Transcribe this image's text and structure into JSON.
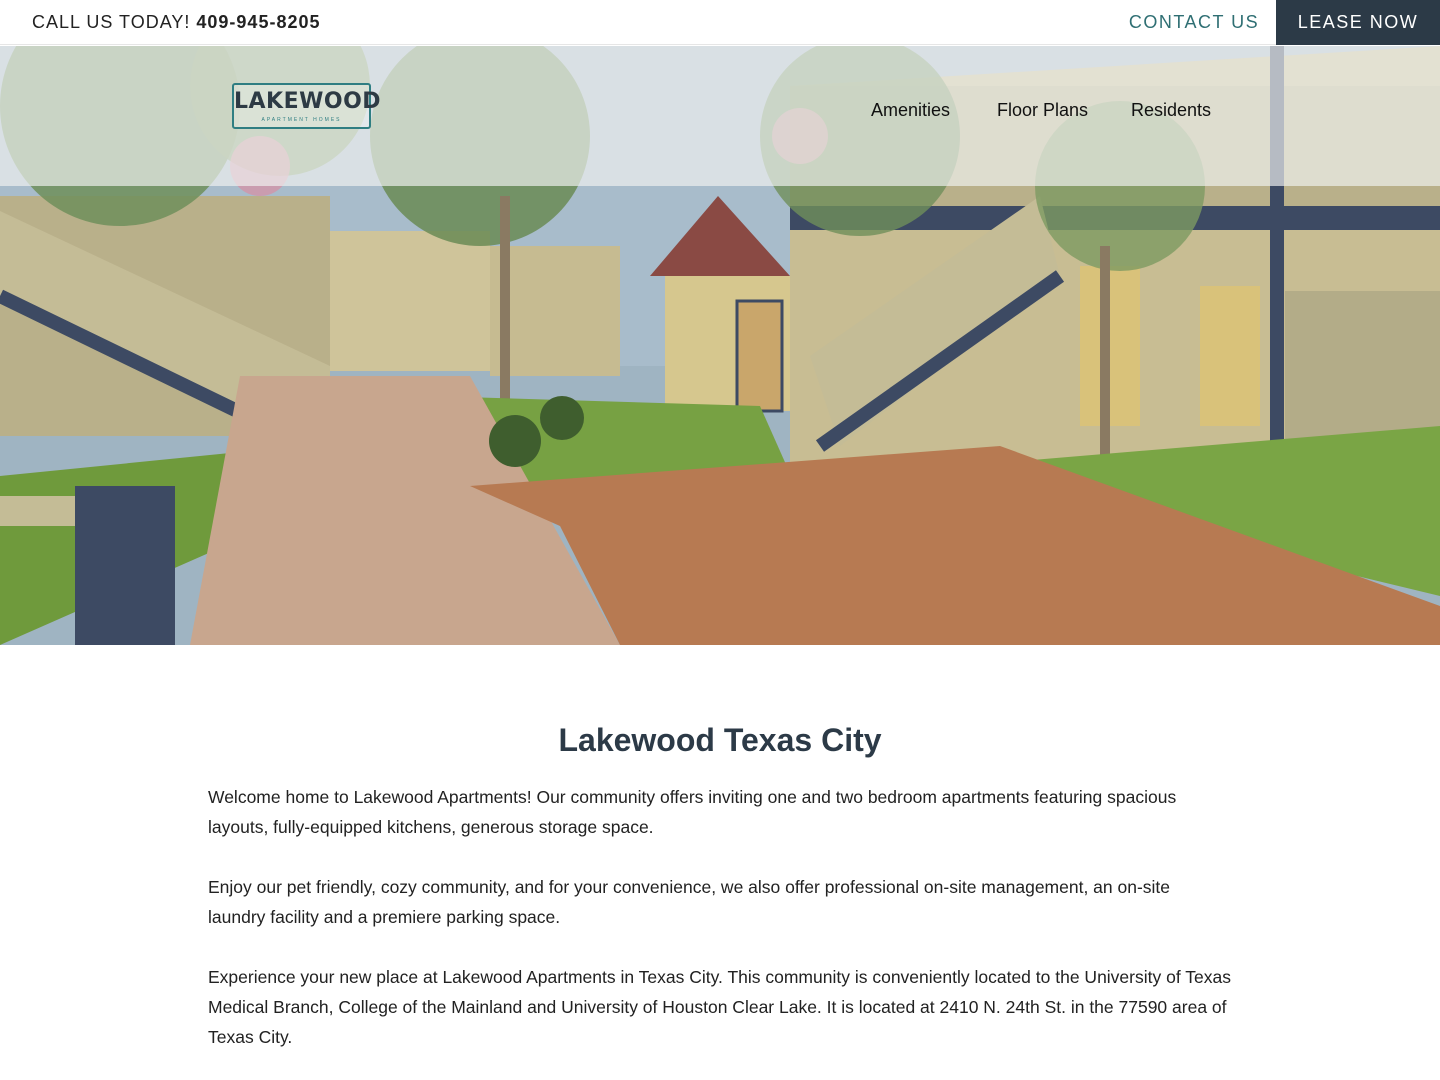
{
  "topbar": {
    "call_label": "CALL US TODAY!",
    "phone": "409-945-8205",
    "contact_label": "CONTACT US",
    "lease_label": "LEASE NOW"
  },
  "header": {
    "logo_text": "LAKEWOOD",
    "logo_sub": "APARTMENT HOMES",
    "nav": [
      {
        "label": "Amenities"
      },
      {
        "label": "Floor Plans"
      },
      {
        "label": "Residents"
      }
    ]
  },
  "main": {
    "title": "Lakewood Texas City",
    "paragraphs": [
      "Welcome home to Lakewood Apartments! Our community offers inviting one and two bedroom apartments featuring spacious layouts, fully-equipped kitchens, generous storage space.",
      "Enjoy our pet friendly, cozy community, and for your convenience, we also offer professional on-site management, an on-site laundry facility and a premiere parking space.",
      "Experience your new place at Lakewood Apartments in Texas City. This community is conveniently located to the University of Texas Medical Branch, College of the Mainland and University of Houston Clear Lake. It is located at 2410 N. 24th St. in the 77590 area of Texas City."
    ]
  },
  "colors": {
    "accent_teal": "#2f6f73",
    "dark_navy": "#2c3a47"
  }
}
